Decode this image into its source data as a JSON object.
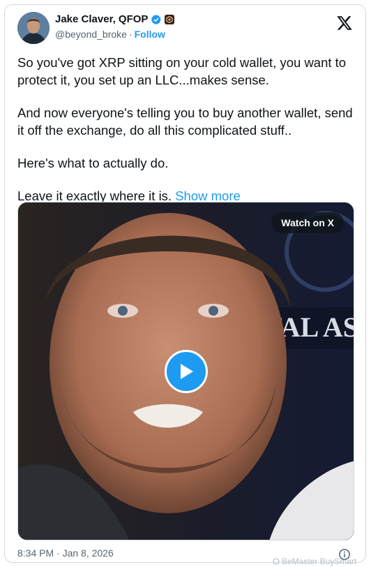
{
  "author": {
    "name": "Jake Claver, QFOP",
    "handle": "@beyond_broke",
    "separator": "·",
    "follow_label": "Follow"
  },
  "tweet": {
    "paragraphs": [
      "So you've got XRP sitting on your cold wallet, you want to protect it, you set up an LLC...makes sense.",
      "And now everyone's telling you to buy another wallet, send it off the exchange, do all this complicated stuff..",
      "Here's what to actually do."
    ],
    "last_line": "Leave it exactly where it is.",
    "show_more_label": "Show more"
  },
  "video": {
    "watch_label": "Watch on X",
    "background_text": "TAL AS"
  },
  "footer": {
    "timestamp": "8:34 PM · Jan 8, 2026",
    "watermark": "BeMaster BuySmart"
  },
  "icons": {
    "verified": "verified-badge-icon",
    "affiliate": "affiliate-badge-icon",
    "x_logo": "x-logo-icon",
    "play": "play-icon",
    "info": "info-icon"
  },
  "colors": {
    "accent": "#1d9bf0",
    "text": "#0f1419",
    "muted": "#536471"
  }
}
